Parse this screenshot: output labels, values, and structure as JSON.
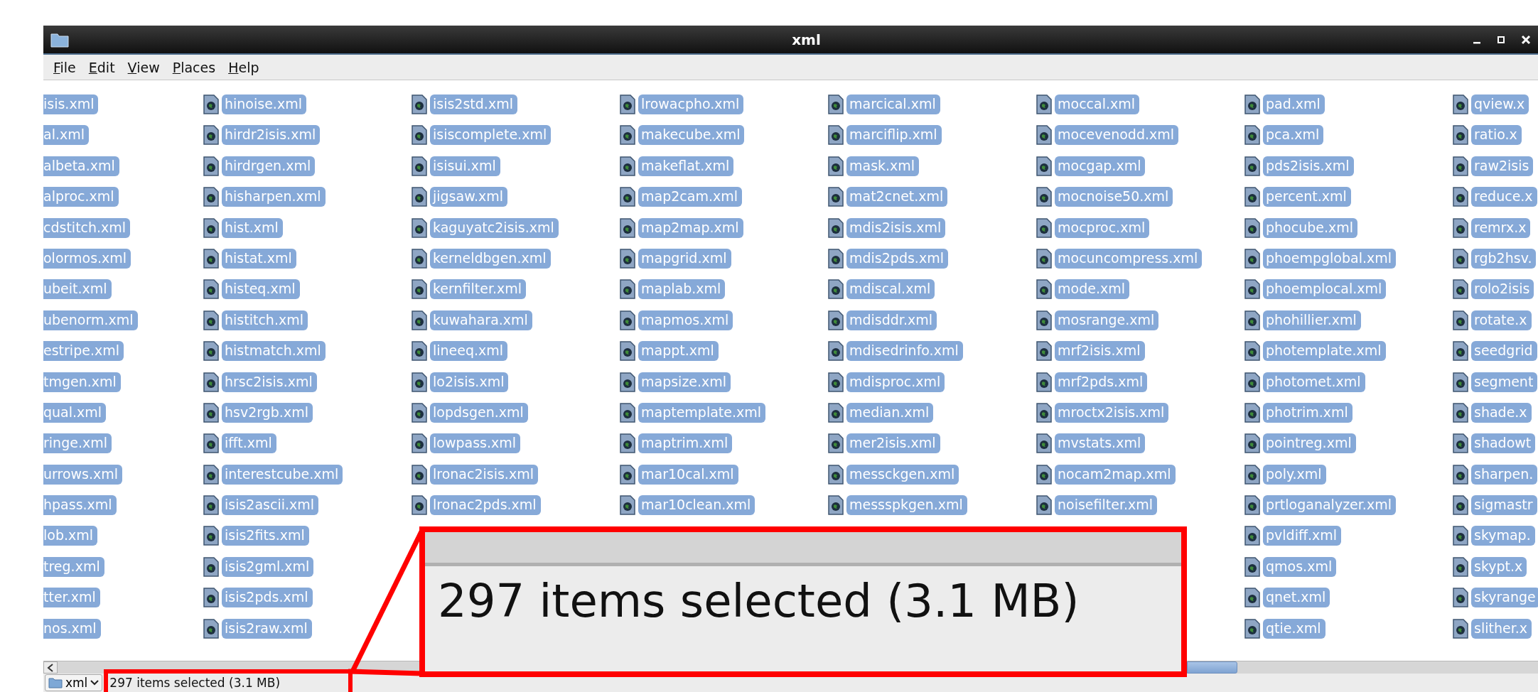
{
  "window": {
    "title": "xml"
  },
  "menu": [
    "File",
    "Edit",
    "View",
    "Places",
    "Help"
  ],
  "columns": [
    {
      "items": [
        {
          "name": "isis.xml",
          "selected": true
        },
        {
          "name": "al.xml",
          "selected": true
        },
        {
          "name": "albeta.xml",
          "selected": true
        },
        {
          "name": "alproc.xml",
          "selected": true
        },
        {
          "name": "cdstitch.xml",
          "selected": true
        },
        {
          "name": "olormos.xml",
          "selected": true
        },
        {
          "name": "ubeit.xml",
          "selected": true
        },
        {
          "name": "ubenorm.xml",
          "selected": true
        },
        {
          "name": "estripe.xml",
          "selected": true
        },
        {
          "name": "tmgen.xml",
          "selected": true
        },
        {
          "name": "qual.xml",
          "selected": true
        },
        {
          "name": "ringe.xml",
          "selected": true
        },
        {
          "name": "urrows.xml",
          "selected": true
        },
        {
          "name": "hpass.xml",
          "selected": true
        },
        {
          "name": "lob.xml",
          "selected": true
        },
        {
          "name": "treg.xml",
          "selected": true
        },
        {
          "name": "tter.xml",
          "selected": true
        },
        {
          "name": "nos.xml",
          "selected": true
        }
      ]
    },
    {
      "items": [
        {
          "name": "hinoise.xml",
          "selected": true
        },
        {
          "name": "hirdr2isis.xml",
          "selected": true
        },
        {
          "name": "hirdrgen.xml",
          "selected": true
        },
        {
          "name": "hisharpen.xml",
          "selected": true
        },
        {
          "name": "hist.xml",
          "selected": true
        },
        {
          "name": "histat.xml",
          "selected": true
        },
        {
          "name": "histeq.xml",
          "selected": true
        },
        {
          "name": "histitch.xml",
          "selected": true
        },
        {
          "name": "histmatch.xml",
          "selected": true
        },
        {
          "name": "hrsc2isis.xml",
          "selected": true
        },
        {
          "name": "hsv2rgb.xml",
          "selected": true
        },
        {
          "name": "ifft.xml",
          "selected": true
        },
        {
          "name": "interestcube.xml",
          "selected": true
        },
        {
          "name": "isis2ascii.xml",
          "selected": true
        },
        {
          "name": "isis2fits.xml",
          "selected": true
        },
        {
          "name": "isis2gml.xml",
          "selected": true
        },
        {
          "name": "isis2pds.xml",
          "selected": true
        },
        {
          "name": "isis2raw.xml",
          "selected": true
        }
      ]
    },
    {
      "items": [
        {
          "name": "isis2std.xml",
          "selected": true
        },
        {
          "name": "isiscomplete.xml",
          "selected": true
        },
        {
          "name": "isisui.xml",
          "selected": true
        },
        {
          "name": "jigsaw.xml",
          "selected": true
        },
        {
          "name": "kaguyatc2isis.xml",
          "selected": true
        },
        {
          "name": "kerneldbgen.xml",
          "selected": true
        },
        {
          "name": "kernfilter.xml",
          "selected": true
        },
        {
          "name": "kuwahara.xml",
          "selected": true
        },
        {
          "name": "lineeq.xml",
          "selected": true
        },
        {
          "name": "lo2isis.xml",
          "selected": true
        },
        {
          "name": "lopdsgen.xml",
          "selected": true
        },
        {
          "name": "lowpass.xml",
          "selected": true
        },
        {
          "name": "lronac2isis.xml",
          "selected": true
        },
        {
          "name": "lronac2pds.xml",
          "selected": true
        }
      ]
    },
    {
      "items": [
        {
          "name": "lrowacpho.xml",
          "selected": true
        },
        {
          "name": "makecube.xml",
          "selected": true
        },
        {
          "name": "makeflat.xml",
          "selected": true
        },
        {
          "name": "map2cam.xml",
          "selected": true
        },
        {
          "name": "map2map.xml",
          "selected": true
        },
        {
          "name": "mapgrid.xml",
          "selected": true
        },
        {
          "name": "maplab.xml",
          "selected": true
        },
        {
          "name": "mapmos.xml",
          "selected": true
        },
        {
          "name": "mappt.xml",
          "selected": true
        },
        {
          "name": "mapsize.xml",
          "selected": true
        },
        {
          "name": "maptemplate.xml",
          "selected": true
        },
        {
          "name": "maptrim.xml",
          "selected": true
        },
        {
          "name": "mar10cal.xml",
          "selected": true
        },
        {
          "name": "mar10clean.xml",
          "selected": true
        }
      ]
    },
    {
      "items": [
        {
          "name": "marcical.xml",
          "selected": true
        },
        {
          "name": "marciflip.xml",
          "selected": true
        },
        {
          "name": "mask.xml",
          "selected": true
        },
        {
          "name": "mat2cnet.xml",
          "selected": true
        },
        {
          "name": "mdis2isis.xml",
          "selected": true
        },
        {
          "name": "mdis2pds.xml",
          "selected": true
        },
        {
          "name": "mdiscal.xml",
          "selected": true
        },
        {
          "name": "mdisddr.xml",
          "selected": true
        },
        {
          "name": "mdisedrinfo.xml",
          "selected": true
        },
        {
          "name": "mdisproc.xml",
          "selected": true
        },
        {
          "name": "median.xml",
          "selected": true
        },
        {
          "name": "mer2isis.xml",
          "selected": true
        },
        {
          "name": "messckgen.xml",
          "selected": true
        },
        {
          "name": "messspkgen.xml",
          "selected": true
        }
      ]
    },
    {
      "items": [
        {
          "name": "moccal.xml",
          "selected": true
        },
        {
          "name": "mocevenodd.xml",
          "selected": true
        },
        {
          "name": "mocgap.xml",
          "selected": true
        },
        {
          "name": "mocnoise50.xml",
          "selected": true
        },
        {
          "name": "mocproc.xml",
          "selected": true
        },
        {
          "name": "mocuncompress.xml",
          "selected": true
        },
        {
          "name": "mode.xml",
          "selected": true
        },
        {
          "name": "mosrange.xml",
          "selected": true
        },
        {
          "name": "mrf2isis.xml",
          "selected": true
        },
        {
          "name": "mrf2pds.xml",
          "selected": true
        },
        {
          "name": "mroctx2isis.xml",
          "selected": true
        },
        {
          "name": "mvstats.xml",
          "selected": true
        },
        {
          "name": "nocam2map.xml",
          "selected": true
        },
        {
          "name": "noisefilter.xml",
          "selected": true
        }
      ]
    },
    {
      "items": [
        {
          "name": "pad.xml",
          "selected": true
        },
        {
          "name": "pca.xml",
          "selected": true
        },
        {
          "name": "pds2isis.xml",
          "selected": true
        },
        {
          "name": "percent.xml",
          "selected": true
        },
        {
          "name": "phocube.xml",
          "selected": true
        },
        {
          "name": "phoempglobal.xml",
          "selected": true
        },
        {
          "name": "phoemplocal.xml",
          "selected": true
        },
        {
          "name": "phohillier.xml",
          "selected": true
        },
        {
          "name": "photemplate.xml",
          "selected": true
        },
        {
          "name": "photomet.xml",
          "selected": true
        },
        {
          "name": "photrim.xml",
          "selected": true
        },
        {
          "name": "pointreg.xml",
          "selected": true
        },
        {
          "name": "poly.xml",
          "selected": true
        },
        {
          "name": "prtloganalyzer.xml",
          "selected": true
        },
        {
          "name": "pvldiff.xml",
          "selected": true
        },
        {
          "name": "qmos.xml",
          "selected": true
        },
        {
          "name": "qnet.xml",
          "selected": true
        },
        {
          "name": "qtie.xml",
          "selected": true
        }
      ]
    },
    {
      "items": [
        {
          "name": "qview.x",
          "selected": true
        },
        {
          "name": "ratio.x",
          "selected": true
        },
        {
          "name": "raw2isis",
          "selected": true
        },
        {
          "name": "reduce.x",
          "selected": true
        },
        {
          "name": "remrx.x",
          "selected": true
        },
        {
          "name": "rgb2hsv.",
          "selected": true
        },
        {
          "name": "rolo2isis",
          "selected": true
        },
        {
          "name": "rotate.x",
          "selected": true
        },
        {
          "name": "seedgrid",
          "selected": true
        },
        {
          "name": "segment",
          "selected": true
        },
        {
          "name": "shade.x",
          "selected": true
        },
        {
          "name": "shadowt",
          "selected": true
        },
        {
          "name": "sharpen.",
          "selected": true
        },
        {
          "name": "sigmastr",
          "selected": true
        },
        {
          "name": "skymap.",
          "selected": true
        },
        {
          "name": "skypt.x",
          "selected": true
        },
        {
          "name": "skyrange",
          "selected": true
        },
        {
          "name": "slither.x",
          "selected": true
        }
      ]
    }
  ],
  "status_bar": {
    "location": "xml",
    "text": "297 items selected (3.1 MB)"
  },
  "callout": {
    "text": "297 items selected (3.1 MB)"
  }
}
